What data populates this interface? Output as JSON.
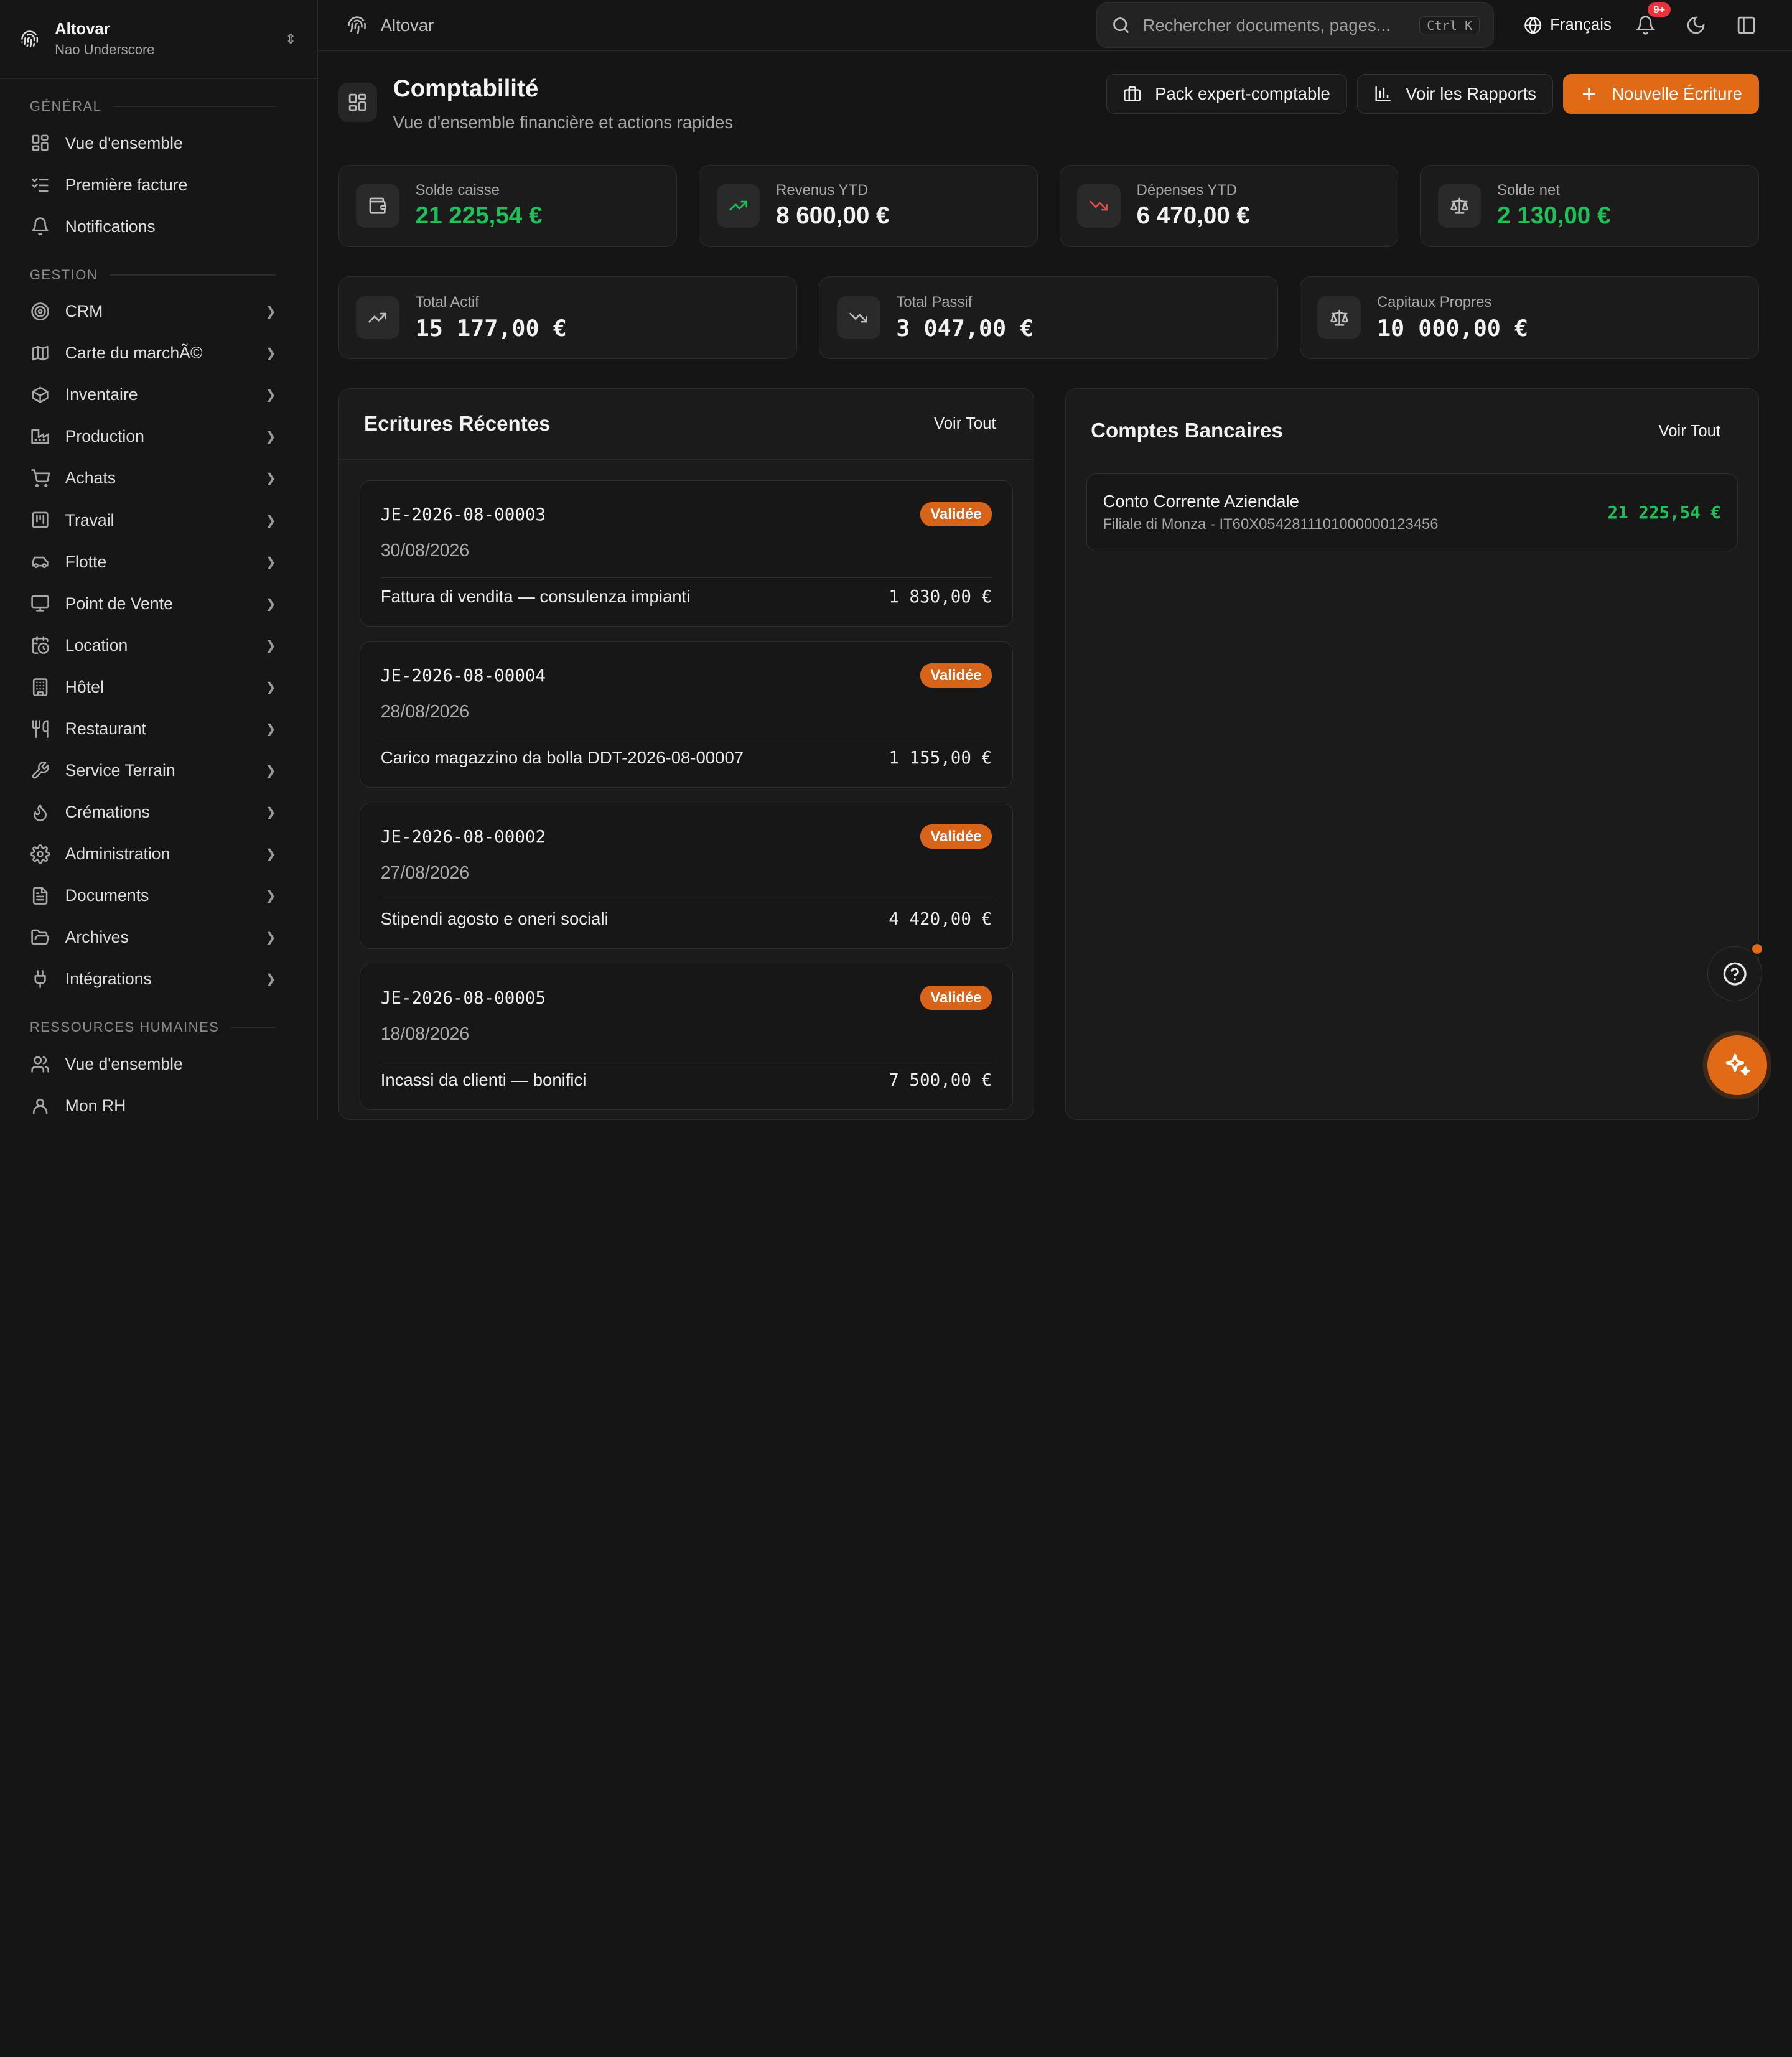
{
  "brand": {
    "name": "Altovar",
    "user": "Nao Underscore"
  },
  "sidebar": {
    "sections": [
      {
        "title": "GÉNÉRAL",
        "items": [
          {
            "label": "Vue d'ensemble",
            "icon": "dashboard-icon",
            "chevron": false
          },
          {
            "label": "Première facture",
            "icon": "checklist-icon",
            "chevron": false
          },
          {
            "label": "Notifications",
            "icon": "bell-icon",
            "chevron": false
          }
        ]
      },
      {
        "title": "GESTION",
        "items": [
          {
            "label": "CRM",
            "icon": "target-icon",
            "chevron": true
          },
          {
            "label": "Carte du marchÃ©",
            "icon": "map-icon",
            "chevron": true
          },
          {
            "label": "Inventaire",
            "icon": "package-icon",
            "chevron": true
          },
          {
            "label": "Production",
            "icon": "factory-icon",
            "chevron": true
          },
          {
            "label": "Achats",
            "icon": "cart-icon",
            "chevron": true
          },
          {
            "label": "Travail",
            "icon": "kanban-icon",
            "chevron": true
          },
          {
            "label": "Flotte",
            "icon": "car-icon",
            "chevron": true
          },
          {
            "label": "Point de Vente",
            "icon": "monitor-icon",
            "chevron": true
          },
          {
            "label": "Location",
            "icon": "calendar-clock-icon",
            "chevron": true
          },
          {
            "label": "Hôtel",
            "icon": "building-icon",
            "chevron": true
          },
          {
            "label": "Restaurant",
            "icon": "utensils-icon",
            "chevron": true
          },
          {
            "label": "Service Terrain",
            "icon": "wrench-icon",
            "chevron": true
          },
          {
            "label": "Crémations",
            "icon": "flame-icon",
            "chevron": true
          },
          {
            "label": "Administration",
            "icon": "settings-icon",
            "chevron": true
          },
          {
            "label": "Documents",
            "icon": "file-icon",
            "chevron": true
          },
          {
            "label": "Archives",
            "icon": "folder-open-icon",
            "chevron": true
          },
          {
            "label": "Intégrations",
            "icon": "plug-icon",
            "chevron": true
          }
        ]
      },
      {
        "title": "RESSOURCES HUMAINES",
        "items": [
          {
            "label": "Vue d'ensemble",
            "icon": "users-icon",
            "chevron": false
          },
          {
            "label": "Mon RH",
            "icon": "user-icon",
            "chevron": false
          }
        ]
      }
    ]
  },
  "topbar": {
    "breadcrumb": "Altovar",
    "search_placeholder": "Rechercher documents, pages...",
    "search_shortcut": "Ctrl K",
    "language": "Français",
    "notification_count": "9+"
  },
  "page": {
    "title": "Comptabilité",
    "subtitle": "Vue d'ensemble financière et actions rapides",
    "actions": {
      "pack": "Pack expert-comptable",
      "reports": "Voir les Rapports",
      "new_entry": "Nouvelle Écriture"
    }
  },
  "stats_top": [
    {
      "label": "Solde caisse",
      "value": "21 225,54 €",
      "icon": "wallet-icon",
      "tone": "green"
    },
    {
      "label": "Revenus YTD",
      "value": "8 600,00 €",
      "icon": "trending-up-icon",
      "tone": "white"
    },
    {
      "label": "Dépenses YTD",
      "value": "6 470,00 €",
      "icon": "trending-down-icon",
      "tone": "white"
    },
    {
      "label": "Solde net",
      "value": "2 130,00 €",
      "icon": "scale-icon",
      "tone": "green"
    }
  ],
  "stats_bottom": [
    {
      "label": "Total Actif",
      "value": "15 177,00 €",
      "icon": "trending-up-icon"
    },
    {
      "label": "Total Passif",
      "value": "3 047,00 €",
      "icon": "trending-down-icon"
    },
    {
      "label": "Capitaux Propres",
      "value": "10 000,00 €",
      "icon": "scale-icon"
    }
  ],
  "recent_entries": {
    "title": "Ecritures Récentes",
    "view_all": "Voir Tout",
    "items": [
      {
        "ref": "JE-2026-08-00003",
        "status": "Validée",
        "date": "30/08/2026",
        "description": "Fattura di vendita — consulenza impianti",
        "amount": "1 830,00 €"
      },
      {
        "ref": "JE-2026-08-00004",
        "status": "Validée",
        "date": "28/08/2026",
        "description": "Carico magazzino da bolla DDT-2026-08-00007",
        "amount": "1 155,00 €"
      },
      {
        "ref": "JE-2026-08-00002",
        "status": "Validée",
        "date": "27/08/2026",
        "description": "Stipendi agosto e oneri sociali",
        "amount": "4 420,00 €"
      },
      {
        "ref": "JE-2026-08-00005",
        "status": "Validée",
        "date": "18/08/2026",
        "description": "Incassi da clienti — bonifici",
        "amount": "7 500,00 €"
      }
    ]
  },
  "bank_accounts": {
    "title": "Comptes Bancaires",
    "view_all": "Voir Tout",
    "items": [
      {
        "name": "Conto Corrente Aziendale",
        "detail": "Filiale di Monza - IT60X0542811101000000123456",
        "balance": "21 225,54 €"
      }
    ]
  },
  "colors": {
    "accent": "#e06a16",
    "positive": "#1fbf5a",
    "negative": "#e5484d",
    "background": "#151515"
  }
}
